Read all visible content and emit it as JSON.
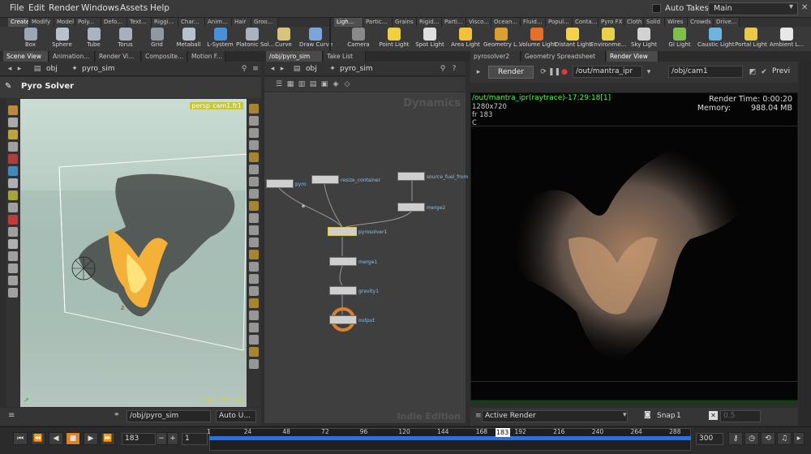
{
  "menubar": {
    "items": [
      "File",
      "Edit",
      "Render",
      "Windows",
      "Assets",
      "Help"
    ],
    "auto_takes": "Auto Takes",
    "desktop": "Main"
  },
  "shelf_tabs_left": [
    "Create",
    "Modify",
    "Model",
    "Poly...",
    "Defo...",
    "Text...",
    "Riggi...",
    "Char...",
    "Anim...",
    "Hair",
    "Groo..."
  ],
  "shelf_tabs_right": [
    "Ligh...",
    "Partic...",
    "Grains",
    "Rigid...",
    "Parti...",
    "Visco...",
    "Ocean...",
    "Fluid...",
    "Popul...",
    "Conta...",
    "Pyro FX",
    "Cloth",
    "Solid",
    "Wires",
    "Crowds",
    "Drive..."
  ],
  "tools_left": [
    {
      "label": "Box",
      "icon": "box-icon",
      "color": "#9aa7b5"
    },
    {
      "label": "Sphere",
      "icon": "sphere-icon",
      "color": "#b9c2cc"
    },
    {
      "label": "Tube",
      "icon": "tube-icon",
      "color": "#aab4c0"
    },
    {
      "label": "Torus",
      "icon": "torus-icon",
      "color": "#a7b0bb"
    },
    {
      "label": "Grid",
      "icon": "grid-icon",
      "color": "#8f99a4"
    },
    {
      "label": "Metaball",
      "icon": "metaball-icon",
      "color": "#b8c2cd"
    },
    {
      "label": "L-System",
      "icon": "lsystem-icon",
      "color": "#4a90d9"
    },
    {
      "label": "Platonic Sol...",
      "icon": "platonic-icon",
      "color": "#a9b3be"
    },
    {
      "label": "Curve",
      "icon": "curve-icon",
      "color": "#d9c27a"
    },
    {
      "label": "Draw Curve",
      "icon": "draw-curve-icon",
      "color": "#7aa6d9"
    }
  ],
  "tools_right": [
    {
      "label": "Camera",
      "icon": "camera-icon",
      "color": "#8a8a8a"
    },
    {
      "label": "Point Light",
      "icon": "point-light-icon",
      "color": "#f0d040"
    },
    {
      "label": "Spot Light",
      "icon": "spot-light-icon",
      "color": "#e0e0e0"
    },
    {
      "label": "Area Light",
      "icon": "area-light-icon",
      "color": "#f3c23a"
    },
    {
      "label": "Geometry L...",
      "icon": "geometry-light-icon",
      "color": "#d8a030"
    },
    {
      "label": "Volume Light",
      "icon": "volume-light-icon",
      "color": "#e6702a"
    },
    {
      "label": "Distant Light",
      "icon": "distant-light-icon",
      "color": "#f2d24a"
    },
    {
      "label": "Environme...",
      "icon": "environment-light-icon",
      "color": "#e9d14c"
    },
    {
      "label": "Sky Light",
      "icon": "sky-light-icon",
      "color": "#d2d2d2"
    },
    {
      "label": "GI Light",
      "icon": "gi-light-icon",
      "color": "#7fbf4a"
    },
    {
      "label": "Caustic Light",
      "icon": "caustic-light-icon",
      "color": "#6fb3e0"
    },
    {
      "label": "Portal Light",
      "icon": "portal-light-icon",
      "color": "#e9c94a"
    },
    {
      "label": "Ambient L...",
      "icon": "ambient-light-icon",
      "color": "#e8e8e8"
    }
  ],
  "left_panel": {
    "tabs": [
      "Scene View",
      "Animation...",
      "Render Vi...",
      "Composite...",
      "Motion F..."
    ],
    "path": [
      "obj",
      "pyro_sim"
    ],
    "title": "Pyro Solver",
    "persp": "persp1",
    "cam": "cam1.fr1",
    "watermark": "Indie Edition",
    "bottom_path": "/obj/pyro_sim",
    "bottom_mode": "Auto U..."
  },
  "mid_panel": {
    "tabs": [
      "/obj/pyro_sim",
      "Take List"
    ],
    "path": [
      "obj",
      "pyro_sim"
    ],
    "context": "Dynamics",
    "watermark": "Indie Edition",
    "nodes": [
      {
        "label": "pyro",
        "name": "pyro"
      },
      {
        "label": "resize_container",
        "name": "resize-container"
      },
      {
        "label": "source_fuel_from",
        "name": "source-fuel-from"
      },
      {
        "label": "merge2",
        "name": "merge2"
      },
      {
        "label": "pyrosolver1",
        "name": "pyrosolver1"
      },
      {
        "label": "merge1",
        "name": "merge1"
      },
      {
        "label": "gravity1",
        "name": "gravity1"
      },
      {
        "label": "output",
        "name": "output"
      }
    ]
  },
  "right_panel": {
    "tabs": [
      "pyrosolver2",
      "Geometry Spreadsheet",
      "Render View"
    ],
    "render_button": "Render",
    "rop_path": "/out/mantra_ipr",
    "cam_path": "/obj/cam1",
    "preview": "Previ",
    "info_line": "/out/mantra_ipr(raytrace)-17:29:18[1]",
    "resolution": "1280x720",
    "frame": "fr 183",
    "channel": "C",
    "render_time": "Render Time: 0:00:20",
    "memory_label": "Memory:",
    "memory_value": "988.04 MB",
    "active_render": "Active Render",
    "snap": "Snap",
    "snap_value": "1",
    "gamma": "0.5"
  },
  "timeline": {
    "current_frame": "183",
    "start": "1",
    "end": "300",
    "ticks": [
      "1",
      "24",
      "48",
      "72",
      "96",
      "120",
      "144",
      "168",
      "192",
      "216",
      "240",
      "264",
      "288"
    ],
    "playhead": "183",
    "range_end": 300,
    "playhead_value": 183
  },
  "colors": {
    "accent_green": "#4cff4c",
    "timeline_blue": "#2f6fd6",
    "node_label": "#8fc0e0"
  }
}
